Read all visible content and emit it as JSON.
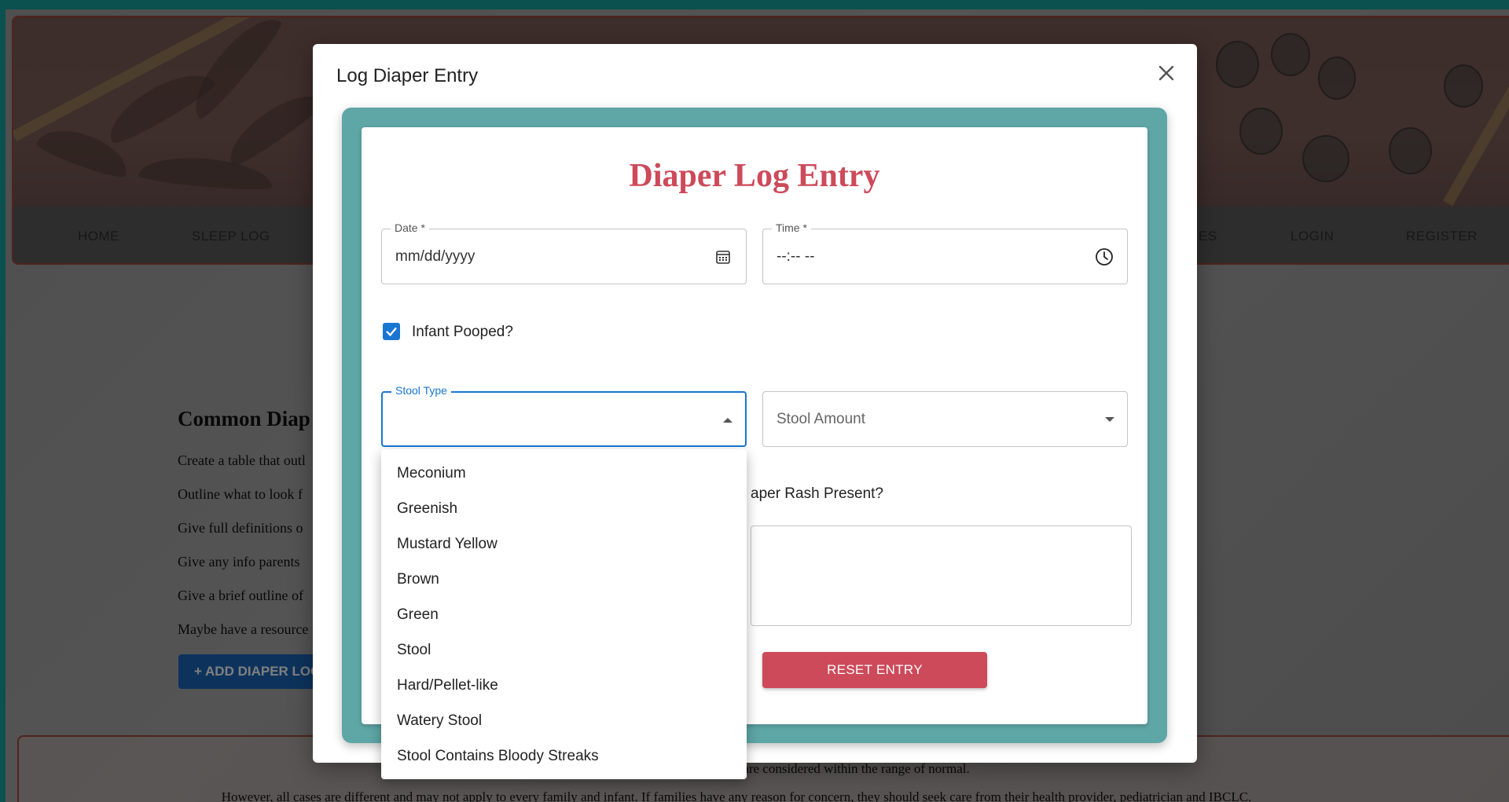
{
  "nav": {
    "items": [
      "HOME",
      "SLEEP LOG",
      "ES",
      "LOGIN",
      "REGISTER"
    ]
  },
  "page": {
    "heading": "Common Diap",
    "lines": [
      "Create a table that outl",
      "Outline what to look f",
      "Give full definitions o",
      "Give any info parents",
      "Give a brief outline of",
      "Maybe have a resource"
    ],
    "add_button": "+ ADD DIAPER LOG",
    "footer_line1": "This ap                                                                                                                               ing and output under conditions that are considered within the range of normal.",
    "footer_line2": "However, all cases are different and may not apply to every family and infant. If families have any reason for concern, they should seek care from their health provider, pediatrician and IBCLC."
  },
  "modal": {
    "title": "Log Diaper Entry",
    "close_symbol": "✕",
    "card_title": "Diaper Log Entry",
    "date": {
      "label": "Date *",
      "value": "mm/dd/yyyy"
    },
    "time": {
      "label": "Time *",
      "value": "--:-- --"
    },
    "pooped": {
      "label": "Infant Pooped?",
      "checked": true
    },
    "stool_type": {
      "label": "Stool Type",
      "value": ""
    },
    "stool_amount": {
      "placeholder": "Stool Amount"
    },
    "rash_label": "aper Rash Present?",
    "reset_button": "RESET ENTRY"
  },
  "dropdown": {
    "options": [
      "Meconium",
      "Greenish",
      "Mustard Yellow",
      "Brown",
      "Green",
      "Stool",
      "Hard/Pellet-like",
      "Watery Stool",
      "Stool Contains Bloody Streaks"
    ]
  },
  "colors": {
    "accent": "#cd4a5a",
    "teal": "#5fa6a6",
    "primary": "#1976d2"
  }
}
